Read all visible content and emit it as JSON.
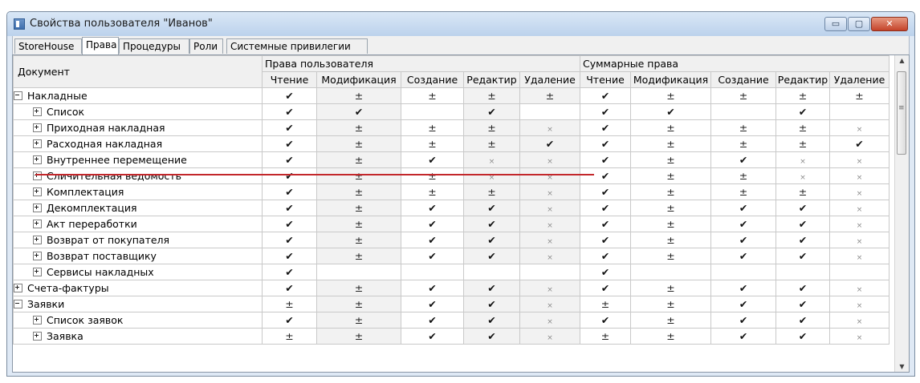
{
  "window": {
    "title": "Свойства пользователя \"Иванов\"",
    "min_label": "▭",
    "max_label": "▢",
    "close_label": "✕"
  },
  "tabs": [
    "StoreHouse",
    "Права",
    "Процедуры",
    "Роли",
    "Системные привилегии"
  ],
  "active_tab": "Права",
  "table": {
    "doc_header": "Документ",
    "groups": [
      "Права пользователя",
      "Суммарные права"
    ],
    "columns": [
      "Чтение",
      "Модификация",
      "Создание",
      "Редактир",
      "Удаление",
      "Чтение",
      "Модификация",
      "Создание",
      "Редактир",
      "Удаление"
    ],
    "rows": [
      {
        "name": "Накладные",
        "level": 0,
        "expander": "minus",
        "cells": [
          "✔",
          "±",
          "±",
          "±",
          "±",
          "✔",
          "±",
          "±",
          "±",
          "±"
        ]
      },
      {
        "name": "Список",
        "level": 1,
        "expander": "plus",
        "cells": [
          "✔",
          "✔",
          "",
          "✔",
          "",
          "✔",
          "✔",
          "",
          "✔",
          ""
        ]
      },
      {
        "name": "Приходная накладная",
        "level": 1,
        "expander": "plus",
        "cells": [
          "✔",
          "±",
          "±",
          "±",
          "×",
          "✔",
          "±",
          "±",
          "±",
          "×"
        ]
      },
      {
        "name": "Расходная накладная",
        "level": 1,
        "expander": "plus",
        "cells": [
          "✔",
          "±",
          "±",
          "±",
          "✔",
          "✔",
          "±",
          "±",
          "±",
          "✔"
        ]
      },
      {
        "name": "Внутреннее перемещение",
        "level": 1,
        "expander": "plus",
        "cells": [
          "✔",
          "±",
          "✔",
          "×",
          "×",
          "✔",
          "±",
          "✔",
          "×",
          "×"
        ]
      },
      {
        "name": "Сличительная ведомость",
        "level": 1,
        "expander": "plus",
        "cells": [
          "✔",
          "±",
          "±",
          "×",
          "×",
          "✔",
          "±",
          "±",
          "×",
          "×"
        ]
      },
      {
        "name": "Комплектация",
        "level": 1,
        "expander": "plus",
        "cells": [
          "✔",
          "±",
          "±",
          "±",
          "×",
          "✔",
          "±",
          "±",
          "±",
          "×"
        ]
      },
      {
        "name": "Декомплектация",
        "level": 1,
        "expander": "plus",
        "cells": [
          "✔",
          "±",
          "✔",
          "✔",
          "×",
          "✔",
          "±",
          "✔",
          "✔",
          "×"
        ]
      },
      {
        "name": "Акт переработки",
        "level": 1,
        "expander": "plus",
        "cells": [
          "✔",
          "±",
          "✔",
          "✔",
          "×",
          "✔",
          "±",
          "✔",
          "✔",
          "×"
        ]
      },
      {
        "name": "Возврат от покупателя",
        "level": 1,
        "expander": "plus",
        "cells": [
          "✔",
          "±",
          "✔",
          "✔",
          "×",
          "✔",
          "±",
          "✔",
          "✔",
          "×"
        ]
      },
      {
        "name": "Возврат поставщику",
        "level": 1,
        "expander": "plus",
        "cells": [
          "✔",
          "±",
          "✔",
          "✔",
          "×",
          "✔",
          "±",
          "✔",
          "✔",
          "×"
        ]
      },
      {
        "name": "Сервисы накладных",
        "level": 1,
        "expander": "plus",
        "cells": [
          "✔",
          "",
          "",
          "",
          "",
          "✔",
          "",
          "",
          "",
          ""
        ]
      },
      {
        "name": "Счета-фактуры",
        "level": 0,
        "expander": "plus",
        "cells": [
          "✔",
          "±",
          "✔",
          "✔",
          "×",
          "✔",
          "±",
          "✔",
          "✔",
          "×"
        ]
      },
      {
        "name": "Заявки",
        "level": 0,
        "expander": "minus",
        "cells": [
          "±",
          "±",
          "✔",
          "✔",
          "×",
          "±",
          "±",
          "✔",
          "✔",
          "×"
        ]
      },
      {
        "name": "Список заявок",
        "level": 1,
        "expander": "plus",
        "cells": [
          "✔",
          "±",
          "✔",
          "✔",
          "×",
          "✔",
          "±",
          "✔",
          "✔",
          "×"
        ]
      },
      {
        "name": "Заявка",
        "level": 1,
        "expander": "plus",
        "cells": [
          "±",
          "±",
          "✔",
          "✔",
          "×",
          "±",
          "±",
          "✔",
          "✔",
          "×"
        ]
      }
    ]
  },
  "colors": {
    "highlight_line": "#c3272b",
    "shaded_cell": "#f2f2f2"
  }
}
